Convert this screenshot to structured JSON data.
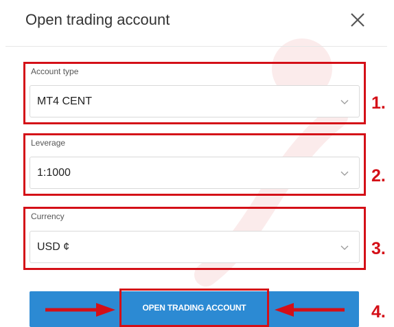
{
  "dialog": {
    "title": "Open trading account",
    "close_icon": "close-icon"
  },
  "fields": [
    {
      "label": "Account type",
      "value": "MT4 CENT",
      "step": "1."
    },
    {
      "label": "Leverage",
      "value": "1:1000",
      "step": "2."
    },
    {
      "label": "Currency",
      "value": "USD ¢",
      "step": "3."
    }
  ],
  "submit": {
    "label": "OPEN TRADING ACCOUNT",
    "step": "4."
  },
  "colors": {
    "accent": "#2c8ad3",
    "annotation": "#d40f17"
  },
  "icons": [
    "close-icon",
    "chevron-down-icon",
    "arrow-right-icon",
    "arrow-left-icon",
    "watermark-logo"
  ]
}
